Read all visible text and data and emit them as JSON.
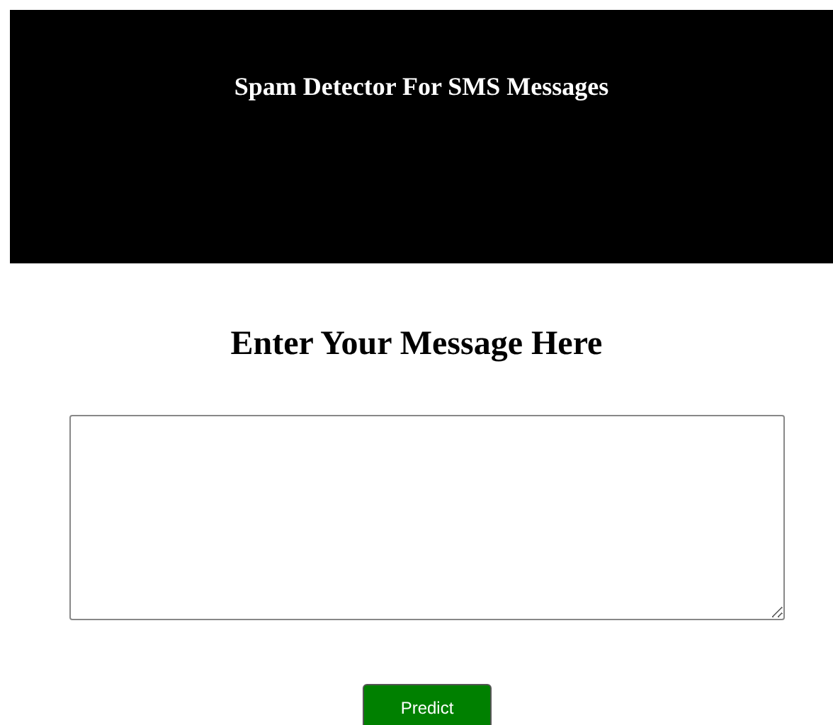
{
  "header": {
    "title": "Spam Detector For SMS Messages"
  },
  "form": {
    "heading": "Enter Your Message Here",
    "button": "Predict"
  }
}
